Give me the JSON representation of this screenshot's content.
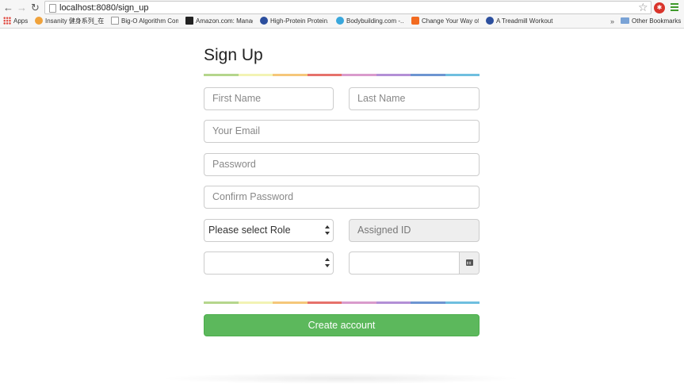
{
  "browser": {
    "url": "localhost:8080/sign_up",
    "bookmarks": [
      {
        "label": "Apps"
      },
      {
        "label": "Insanity 健身系列_在线..."
      },
      {
        "label": "Big-O Algorithm Com..."
      },
      {
        "label": "Amazon.com: Manag..."
      },
      {
        "label": "High-Protein Protein..."
      },
      {
        "label": "Bodybuilding.com -..."
      },
      {
        "label": "Change Your Way of..."
      },
      {
        "label": "A Treadmill Workout"
      }
    ],
    "more_label": "»",
    "other_bookmarks": "Other Bookmarks"
  },
  "form": {
    "title": "Sign Up",
    "first_name_placeholder": "First Name",
    "last_name_placeholder": "Last Name",
    "email_placeholder": "Your Email",
    "password_placeholder": "Password",
    "confirm_password_placeholder": "Confirm Password",
    "role_selected": "Please select Role",
    "assigned_id_placeholder": "Assigned ID",
    "second_select_value": "",
    "date_value": "",
    "submit_label": "Create account"
  },
  "rainbow_colors": [
    "#b5d68c",
    "#f2f3b4",
    "#f5c77a",
    "#e6716b",
    "#d99bcc",
    "#b38fd6",
    "#6d95d1",
    "#6fbfdf"
  ],
  "accent": "#5cb85c"
}
